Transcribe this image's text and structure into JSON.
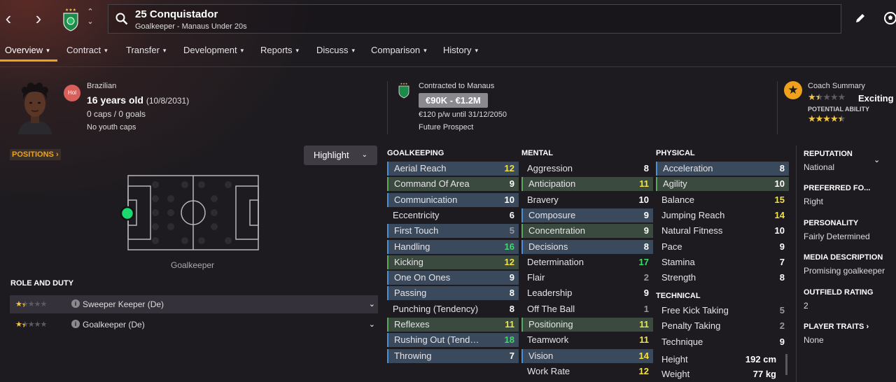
{
  "header": {
    "player_name": "25 Conquistador",
    "subtitle": "Goalkeeper - Manaus Under 20s"
  },
  "icons": {
    "back": "chevron-left-icon",
    "forward": "chevron-right-icon",
    "search": "search-icon",
    "edit": "pencil-icon",
    "ball": "football-icon"
  },
  "tabs": [
    {
      "label": "Overview"
    },
    {
      "label": "Contract"
    },
    {
      "label": "Transfer"
    },
    {
      "label": "Development"
    },
    {
      "label": "Reports"
    },
    {
      "label": "Discuss"
    },
    {
      "label": "Comparison"
    },
    {
      "label": "History"
    }
  ],
  "bio": {
    "nationality": "Brazilian",
    "hol_label": "Hol",
    "age": "16 years old",
    "dob": "(10/8/2031)",
    "caps": "0 caps / 0 goals",
    "youth_caps": "No youth caps"
  },
  "contract": {
    "title": "Contracted to Manaus",
    "value": "€90K - €1.2M",
    "wage": "€120 p/w until 31/12/2050",
    "status": "Future Prospect"
  },
  "coach": {
    "title": "Coach Summary",
    "current_stars": 1.5,
    "description": "Exciting y",
    "pa_label": "POTENTIAL ABILITY",
    "potential_stars": 4.5
  },
  "positions": {
    "header": "POSITIONS",
    "highlight": "Highlight",
    "position_label": "Goalkeeper"
  },
  "roles": {
    "header": "ROLE AND DUTY",
    "items": [
      {
        "name": "Sweeper Keeper (De)",
        "stars": 1.5
      },
      {
        "name": "Goalkeeper (De)",
        "stars": 1.5
      }
    ]
  },
  "columns": {
    "goalkeeping": {
      "title": "GOALKEEPING",
      "items": [
        {
          "name": "Aerial Reach",
          "value": "12",
          "hl": "b"
        },
        {
          "name": "Command Of Area",
          "value": "9",
          "hl": "g"
        },
        {
          "name": "Communication",
          "value": "10",
          "hl": "b"
        },
        {
          "name": "Eccentricity",
          "value": "6",
          "hl": ""
        },
        {
          "name": "First Touch",
          "value": "5",
          "hl": "b"
        },
        {
          "name": "Handling",
          "value": "16",
          "hl": "b"
        },
        {
          "name": "Kicking",
          "value": "12",
          "hl": "g"
        },
        {
          "name": "One On Ones",
          "value": "9",
          "hl": "b"
        },
        {
          "name": "Passing",
          "value": "8",
          "hl": "b"
        },
        {
          "name": "Punching (Tendency)",
          "value": "8",
          "hl": ""
        },
        {
          "name": "Reflexes",
          "value": "11",
          "hl": "g"
        },
        {
          "name": "Rushing Out (Tend…",
          "value": "18",
          "hl": "b"
        },
        {
          "name": "Throwing",
          "value": "7",
          "hl": "b"
        }
      ]
    },
    "mental": {
      "title": "MENTAL",
      "items": [
        {
          "name": "Aggression",
          "value": "8",
          "hl": ""
        },
        {
          "name": "Anticipation",
          "value": "11",
          "hl": "g"
        },
        {
          "name": "Bravery",
          "value": "10",
          "hl": ""
        },
        {
          "name": "Composure",
          "value": "9",
          "hl": "b"
        },
        {
          "name": "Concentration",
          "value": "9",
          "hl": "g"
        },
        {
          "name": "Decisions",
          "value": "8",
          "hl": "b"
        },
        {
          "name": "Determination",
          "value": "17",
          "hl": ""
        },
        {
          "name": "Flair",
          "value": "2",
          "hl": ""
        },
        {
          "name": "Leadership",
          "value": "9",
          "hl": ""
        },
        {
          "name": "Off The Ball",
          "value": "1",
          "hl": ""
        },
        {
          "name": "Positioning",
          "value": "11",
          "hl": "g"
        },
        {
          "name": "Teamwork",
          "value": "11",
          "hl": ""
        },
        {
          "name": "Vision",
          "value": "14",
          "hl": "b"
        },
        {
          "name": "Work Rate",
          "value": "12",
          "hl": ""
        }
      ]
    },
    "physical": {
      "title": "PHYSICAL",
      "items": [
        {
          "name": "Acceleration",
          "value": "8",
          "hl": "b"
        },
        {
          "name": "Agility",
          "value": "10",
          "hl": "g"
        },
        {
          "name": "Balance",
          "value": "15",
          "hl": ""
        },
        {
          "name": "Jumping Reach",
          "value": "14",
          "hl": ""
        },
        {
          "name": "Natural Fitness",
          "value": "10",
          "hl": ""
        },
        {
          "name": "Pace",
          "value": "9",
          "hl": ""
        },
        {
          "name": "Stamina",
          "value": "7",
          "hl": ""
        },
        {
          "name": "Strength",
          "value": "8",
          "hl": ""
        }
      ]
    },
    "technical": {
      "title": "TECHNICAL",
      "items": [
        {
          "name": "Free Kick Taking",
          "value": "5",
          "hl": ""
        },
        {
          "name": "Penalty Taking",
          "value": "2",
          "hl": ""
        },
        {
          "name": "Technique",
          "value": "9",
          "hl": ""
        }
      ]
    },
    "body": [
      {
        "name": "Height",
        "value": "192 cm"
      },
      {
        "name": "Weight",
        "value": "77 kg"
      }
    ]
  },
  "right_panel": [
    {
      "label": "REPUTATION",
      "value": "National"
    },
    {
      "label": "PREFERRED FO...",
      "value": "Right"
    },
    {
      "label": "PERSONALITY",
      "value": "Fairly Determined"
    },
    {
      "label": "MEDIA DESCRIPTION",
      "value": "Promising goalkeeper"
    },
    {
      "label": "OUTFIELD RATING",
      "value": "2"
    },
    {
      "label": "PLAYER TRAITS",
      "value": "None"
    }
  ],
  "colors": {
    "accent": "#f0a11c",
    "value_low": "#9a979e",
    "value_mid": "#ffffff",
    "value_good": "#f3e244",
    "value_high": "#3ddc6a",
    "blue_hl": "#3a4a5c",
    "green_hl": "#3a4a3e"
  }
}
